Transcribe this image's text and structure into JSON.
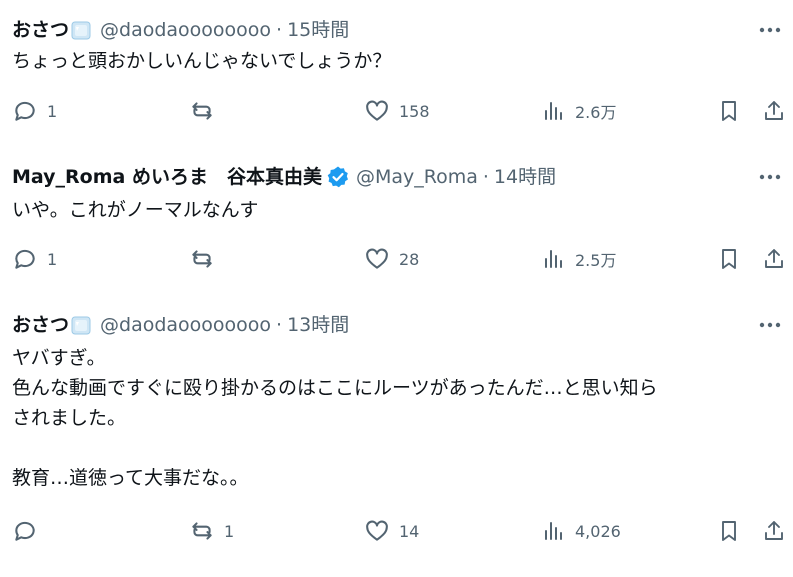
{
  "posts": [
    {
      "display_name": "おさつ",
      "name_icon": "ice-cube-icon",
      "handle": "@daodaoooooooo",
      "dot": "·",
      "time": "15時間",
      "verified": false,
      "text_lines": [
        "ちょっと頭おかしいんじゃないでしょうか？"
      ],
      "replies": "1",
      "reposts": "",
      "likes": "158",
      "views": "2.6万"
    },
    {
      "display_name": "May_Roma めいろま　谷本真由美",
      "name_icon": "verified-badge-icon",
      "handle": "@May_Roma",
      "dot": "·",
      "time": "14時間",
      "verified": true,
      "text_lines": [
        "いや。これがノーマルなんす"
      ],
      "replies": "1",
      "reposts": "",
      "likes": "28",
      "views": "2.5万"
    },
    {
      "display_name": "おさつ",
      "name_icon": "ice-cube-icon",
      "handle": "@daodaoooooooo",
      "dot": "·",
      "time": "13時間",
      "verified": false,
      "text_lines": [
        "ヤバすぎ。",
        "色んな動画ですぐに殴り掛かるのはここにルーツがあったんだ…と思い知ら",
        "されました。",
        "",
        "教育…道徳って大事だな。。"
      ],
      "replies": "",
      "reposts": "1",
      "likes": "14",
      "views": "4,026"
    }
  ],
  "colors": {
    "text": "#0f1419",
    "secondary": "#536471",
    "verified": "#1d9bf0",
    "ice": "#cfe6f5"
  }
}
